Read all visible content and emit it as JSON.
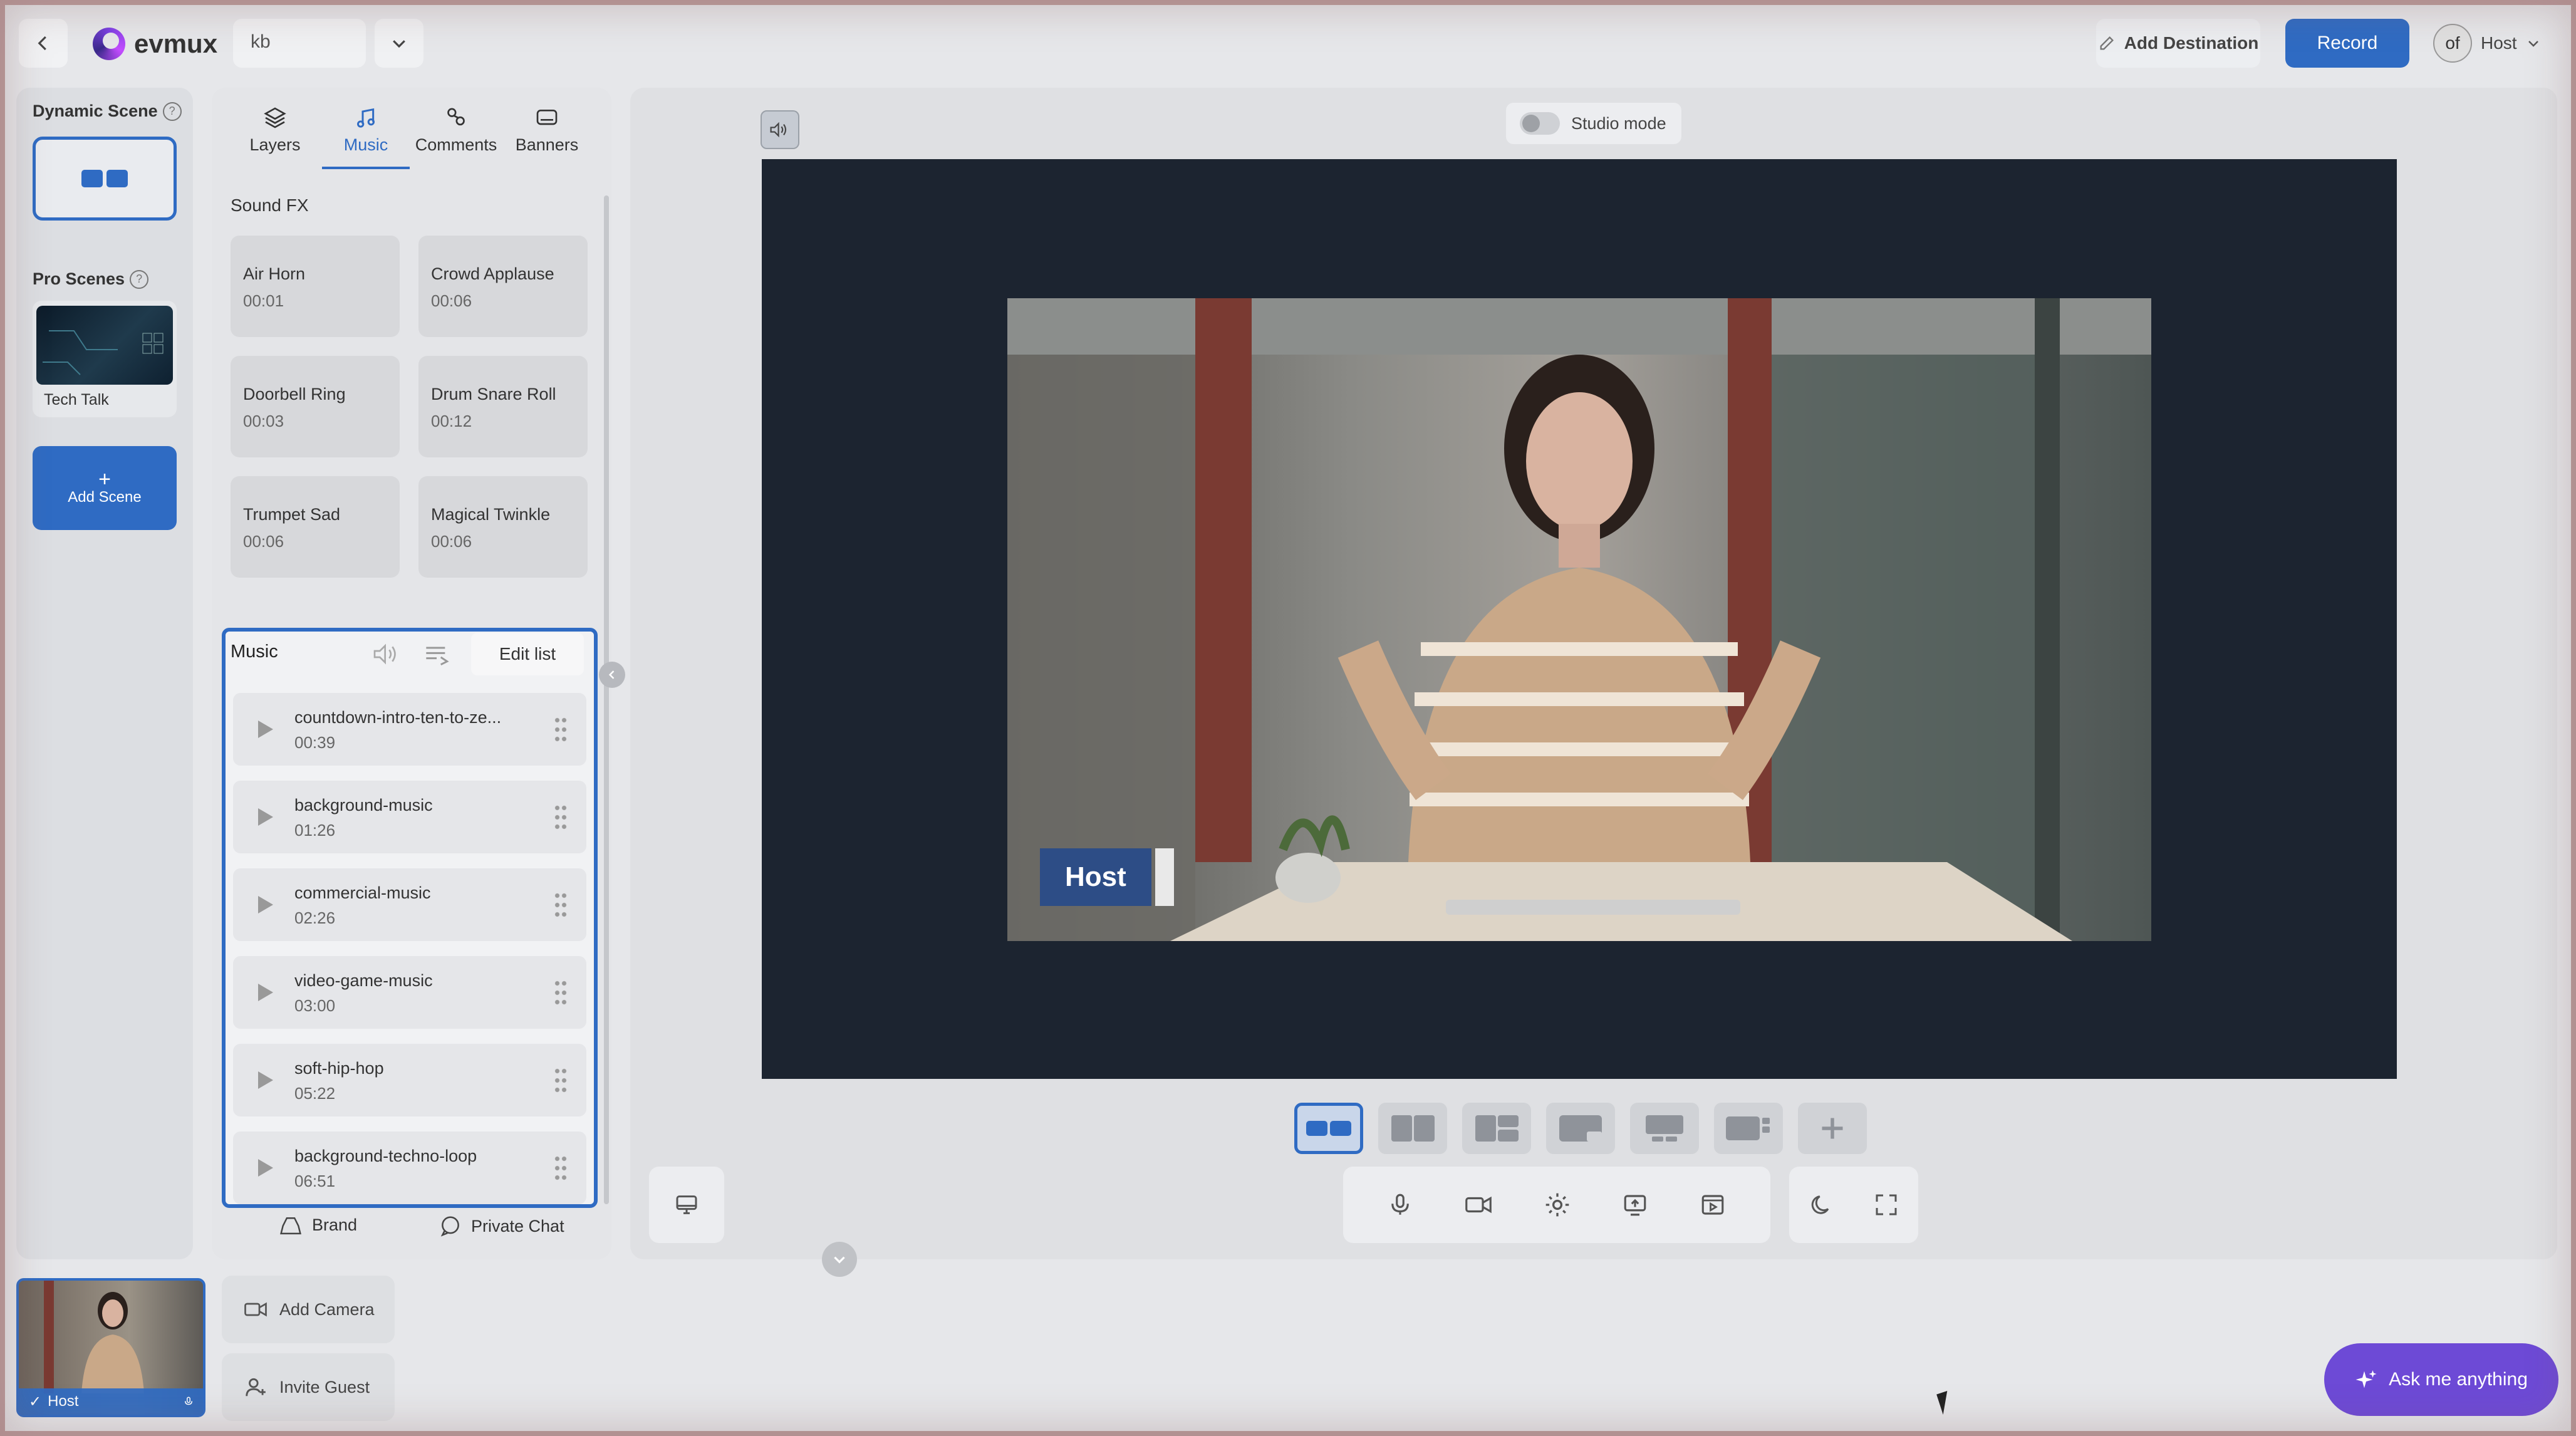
{
  "topbar": {
    "brand": "evmux",
    "project": "kb",
    "add_destination": "Add Destination",
    "record": "Record",
    "avatar_text": "of",
    "host": "Host"
  },
  "scenes": {
    "dynamic_label": "Dynamic Scene",
    "pro_label": "Pro Scenes",
    "pro_item": "Tech Talk",
    "add_scene": "Add Scene"
  },
  "tabs": [
    {
      "label": "Layers",
      "icon": "layers-icon"
    },
    {
      "label": "Music",
      "icon": "music-note-icon"
    },
    {
      "label": "Comments",
      "icon": "comments-icon"
    },
    {
      "label": "Banners",
      "icon": "banner-icon"
    }
  ],
  "sound_fx": {
    "title": "Sound FX",
    "items": [
      {
        "name": "Air Horn",
        "duration": "00:01"
      },
      {
        "name": "Crowd Applause",
        "duration": "00:06"
      },
      {
        "name": "Doorbell Ring",
        "duration": "00:03"
      },
      {
        "name": "Drum Snare Roll",
        "duration": "00:12"
      },
      {
        "name": "Trumpet Sad",
        "duration": "00:06"
      },
      {
        "name": "Magical Twinkle",
        "duration": "00:06"
      }
    ]
  },
  "music": {
    "title": "Music",
    "edit_list": "Edit list",
    "tracks": [
      {
        "name": "countdown-intro-ten-to-ze...",
        "duration": "00:39"
      },
      {
        "name": "background-music",
        "duration": "01:26"
      },
      {
        "name": "commercial-music",
        "duration": "02:26"
      },
      {
        "name": "video-game-music",
        "duration": "03:00"
      },
      {
        "name": "soft-hip-hop",
        "duration": "05:22"
      },
      {
        "name": "background-techno-loop",
        "duration": "06:51"
      }
    ]
  },
  "panel_footer": {
    "brand": "Brand",
    "private_chat": "Private Chat"
  },
  "stage": {
    "studio_mode": "Studio mode",
    "lower_third": "Host"
  },
  "tray": {
    "host_tile": "Host",
    "add_camera": "Add Camera",
    "invite_guest": "Invite Guest",
    "ask": "Ask me anything"
  },
  "colors": {
    "accent": "#2f6bc3",
    "ask_button": "#6d4ad6",
    "canvas": "#1c2430",
    "lower_third": "#2d4d86"
  }
}
